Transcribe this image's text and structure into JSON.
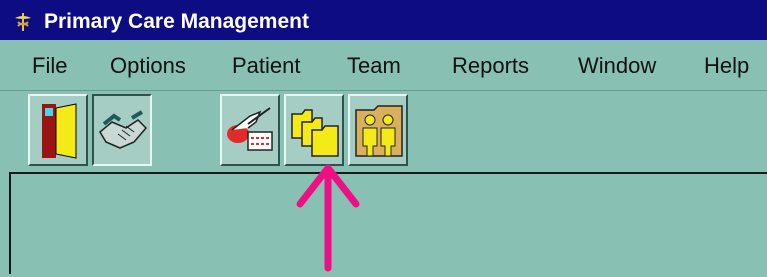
{
  "window": {
    "title": "Primary Care Management"
  },
  "menu": {
    "items": [
      {
        "label": "File"
      },
      {
        "label": "Options"
      },
      {
        "label": "Patient"
      },
      {
        "label": "Team"
      },
      {
        "label": "Reports"
      },
      {
        "label": "Window"
      },
      {
        "label": "Help"
      }
    ]
  },
  "toolbar": {
    "buttons": [
      {
        "icon": "exit-door-icon",
        "pressed": false
      },
      {
        "icon": "handshake-icon",
        "pressed": true
      },
      {
        "icon": "clinic-icon",
        "pressed": false
      },
      {
        "icon": "folders-icon",
        "pressed": false
      },
      {
        "icon": "team-folder-icon",
        "pressed": false
      }
    ]
  },
  "annotation": {
    "icon": "pointer-arrow-icon",
    "color": "#ee0f84"
  },
  "colors": {
    "titlebar": "#0e0c82",
    "workspace": "#88c0b4"
  }
}
